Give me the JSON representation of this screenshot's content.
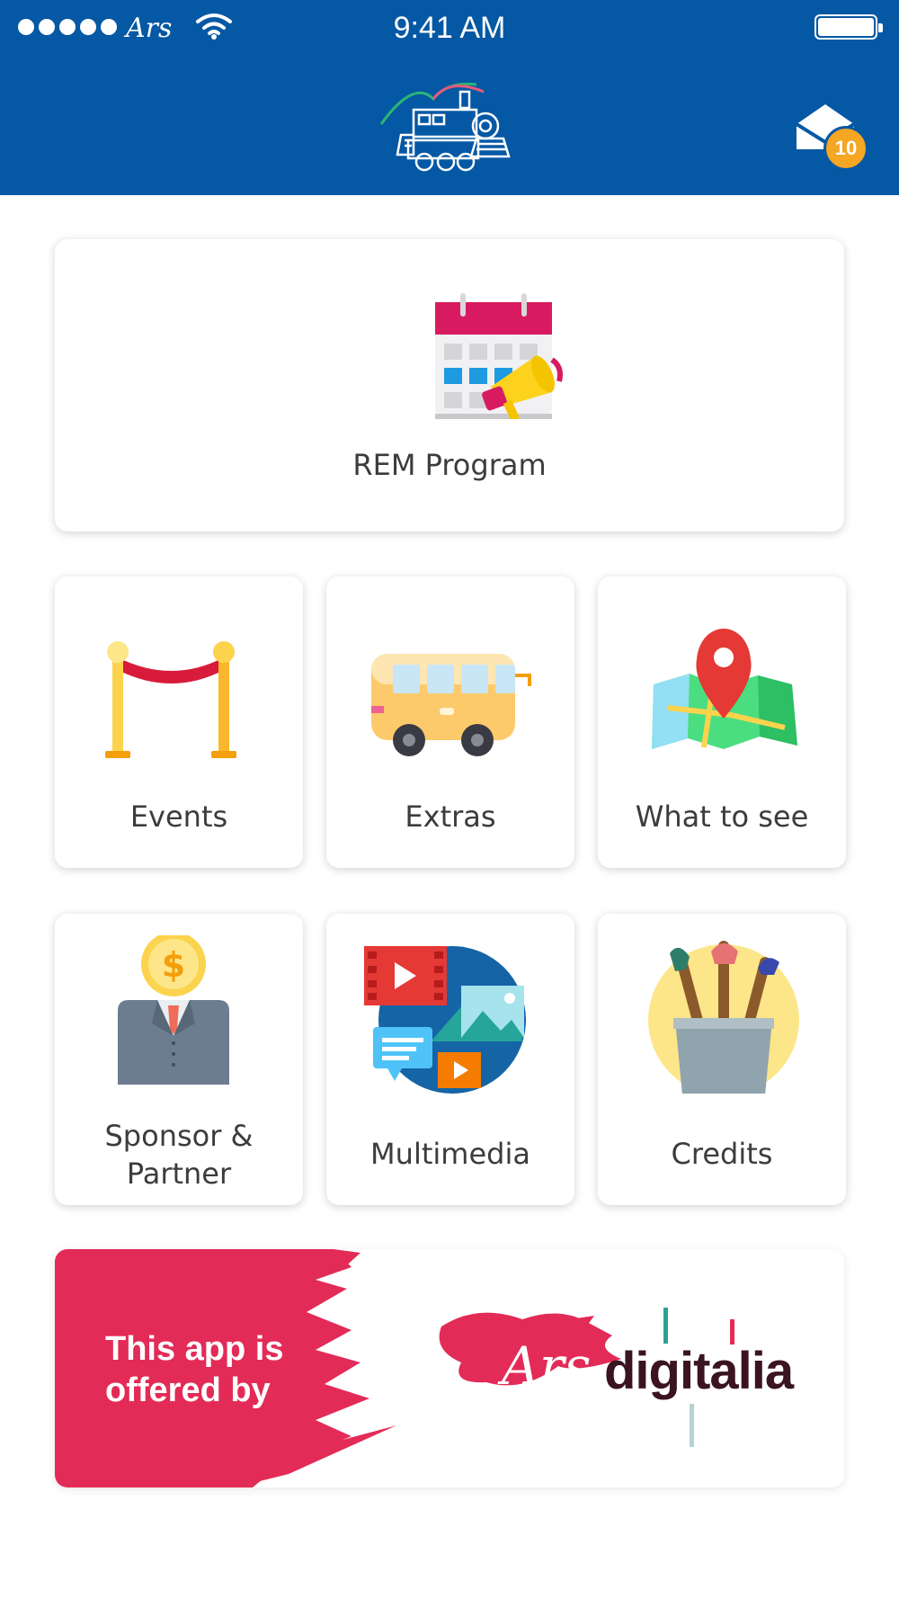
{
  "status_bar": {
    "carrier": "Ars",
    "time": "9:41 AM",
    "signal_dots": 5
  },
  "header": {
    "logo_icon": "steam-train-logo",
    "inbox_icon": "envelope-icon",
    "inbox_count": "10"
  },
  "menu": {
    "rem_program": "REM Program",
    "events": "Events",
    "extras": "Extras",
    "what_to_see": "What to see",
    "sponsor_line1": "Sponsor &",
    "sponsor_line2": "Partner",
    "multimedia": "Multimedia",
    "credits": "Credits"
  },
  "banner": {
    "offered_line1": "This app is",
    "offered_line2": "offered by",
    "brand_ars": "Ars",
    "brand_digitalia": "digitalia"
  },
  "colors": {
    "header_bg": "#0558a4",
    "badge": "#f5a623",
    "banner_accent": "#e32b57"
  }
}
